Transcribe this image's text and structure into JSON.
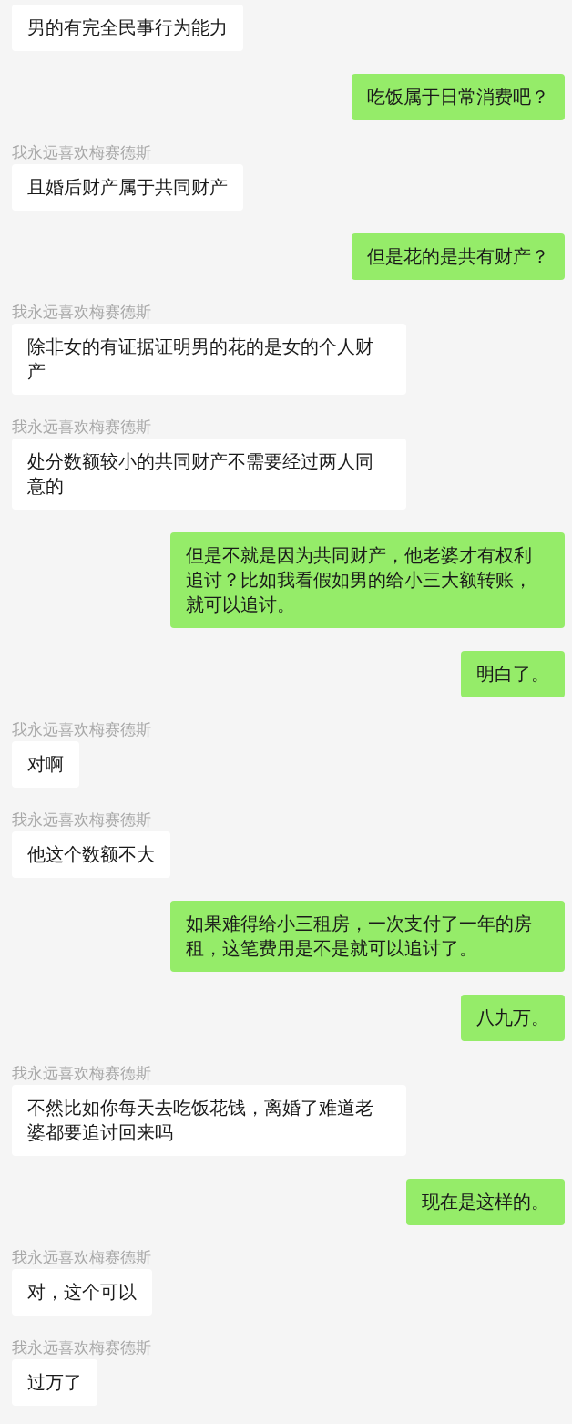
{
  "messages": [
    {
      "kind": "received",
      "text": "男的有完全民事行为能力"
    },
    {
      "kind": "sent",
      "text": "吃饭属于日常消费吧？"
    },
    {
      "kind": "received",
      "sender": "我永远喜欢梅赛德斯",
      "text": "且婚后财产属于共同财产"
    },
    {
      "kind": "sent",
      "text": "但是花的是共有财产？"
    },
    {
      "kind": "received",
      "sender": "我永远喜欢梅赛德斯",
      "text": "除非女的有证据证明男的花的是女的个人财产"
    },
    {
      "kind": "received",
      "sender": "我永远喜欢梅赛德斯",
      "text": "处分数额较小的共同财产不需要经过两人同意的"
    },
    {
      "kind": "sent",
      "text": "但是不就是因为共同财产，他老婆才有权利追讨？比如我看假如男的给小三大额转账，就可以追讨。"
    },
    {
      "kind": "sent",
      "text": "明白了。"
    },
    {
      "kind": "received",
      "sender": "我永远喜欢梅赛德斯",
      "text": "对啊"
    },
    {
      "kind": "received",
      "sender": "我永远喜欢梅赛德斯",
      "text": "他这个数额不大"
    },
    {
      "kind": "sent",
      "text": "如果难得给小三租房，一次支付了一年的房租，这笔费用是不是就可以追讨了。"
    },
    {
      "kind": "sent",
      "text": "八九万。"
    },
    {
      "kind": "received",
      "sender": "我永远喜欢梅赛德斯",
      "text": "不然比如你每天去吃饭花钱，离婚了难道老婆都要追讨回来吗"
    },
    {
      "kind": "sent",
      "text": "现在是这样的。"
    },
    {
      "kind": "received",
      "sender": "我永远喜欢梅赛德斯",
      "text": "对，这个可以"
    },
    {
      "kind": "received",
      "sender": "我永远喜欢梅赛德斯",
      "text": "过万了"
    }
  ]
}
